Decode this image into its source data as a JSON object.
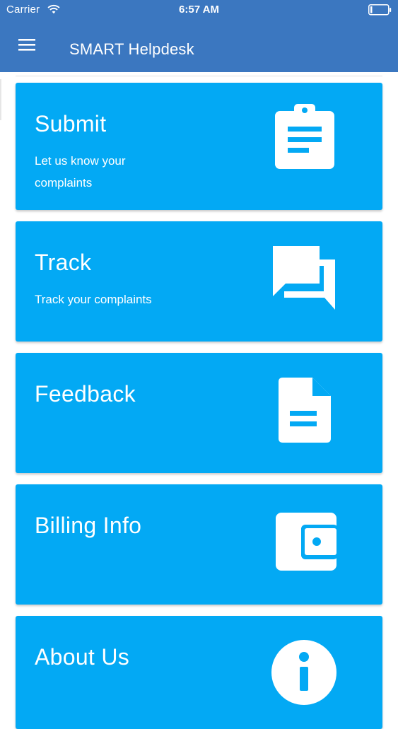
{
  "status_bar": {
    "carrier": "Carrier",
    "time": "6:57 AM",
    "icons": [
      "wifi-icon",
      "battery-icon"
    ]
  },
  "app_bar": {
    "title": "SMART Helpdesk",
    "menu_icon": "hamburger-menu-icon",
    "background_color": "#3b77c0"
  },
  "cards": [
    {
      "title": "Submit",
      "subtitle": "Let us know your complaints",
      "icon": "clipboard-icon",
      "color": "#03a9f4"
    },
    {
      "title": "Track",
      "subtitle": "Track your complaints",
      "icon": "chat-bubbles-icon",
      "color": "#03a9f4"
    },
    {
      "title": "Feedback",
      "subtitle": "",
      "icon": "document-icon",
      "color": "#03a9f4"
    },
    {
      "title": "Billing Info",
      "subtitle": "",
      "icon": "wallet-icon",
      "color": "#03a9f4"
    },
    {
      "title": "About Us",
      "subtitle": "",
      "icon": "info-icon",
      "color": "#03a9f4"
    }
  ]
}
